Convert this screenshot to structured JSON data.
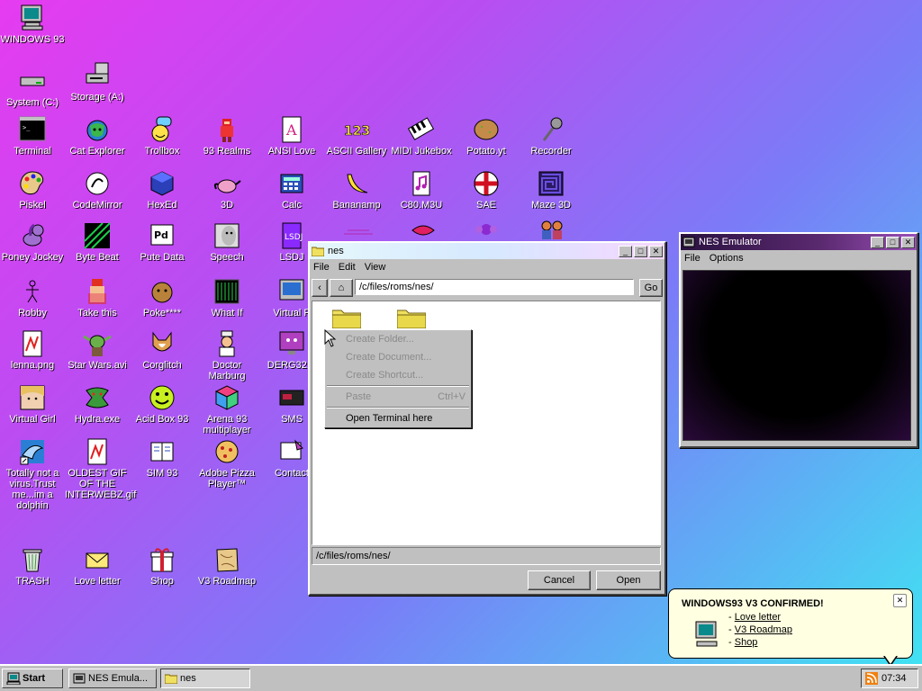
{
  "desktop": {
    "top_icons": [
      {
        "label": "WINDOWS 93",
        "icon": "computer-icon"
      },
      {
        "label": "System (C:)",
        "icon": "drive-icon"
      },
      {
        "label": "Storage (A:)",
        "icon": "floppy-drive-icon"
      }
    ],
    "icons_row1": [
      "Terminal",
      "Cat Explorer",
      "Trollbox",
      "93 Realms",
      "ANSI Love",
      "ASCII Gallery",
      "MIDI Jukebox",
      "Potato.yt",
      "Recorder"
    ],
    "icons_row2": [
      "Piskel",
      "CodeMirror",
      "HexEd",
      "3D",
      "Calc",
      "Bananamp",
      "C80.M3U",
      "SAE",
      "Maze 3D"
    ],
    "icons_row3": [
      "Poney Jockey",
      "Byte Beat",
      "Pute Data",
      "Speech",
      "LSDJ"
    ],
    "icons_row4": [
      "Robby",
      "Take this",
      "Poke****",
      "What If",
      "Virtual P"
    ],
    "icons_row5": [
      "lenna.png",
      "Star Wars.avi",
      "Corglitch",
      "Doctor Marburg",
      "DERG32.E"
    ],
    "icons_row6": [
      "Virtual Girl",
      "Hydra.exe",
      "Acid Box 93",
      "Arena 93 multiplayer",
      "SMS"
    ],
    "icons_row7": [
      "Totally not a virus.Trust me...im a dolphin",
      "OLDEST GIF OF THE INTERWEBZ.gif",
      "SIM 93",
      "Adobe Pizza Player™",
      "Contact"
    ],
    "icons_row8": [
      "TRASH",
      "Love letter",
      "Shop",
      "V3 Roadmap"
    ]
  },
  "file_window": {
    "title": "nes",
    "menu": [
      "File",
      "Edit",
      "View"
    ],
    "path": "/c/files/roms/nes/",
    "go_label": "Go",
    "status_path": "/c/files/roms/nes/",
    "cancel_label": "Cancel",
    "open_label": "Open"
  },
  "context_menu": {
    "items": [
      {
        "label": "Create Folder...",
        "enabled": false
      },
      {
        "label": "Create Document...",
        "enabled": false
      },
      {
        "label": "Create Shortcut...",
        "enabled": false
      },
      {
        "label": "Paste",
        "accel": "Ctrl+V",
        "enabled": false
      },
      {
        "label": "Open Terminal here",
        "enabled": true
      }
    ]
  },
  "nes_window": {
    "title": "NES Emulator",
    "menu": [
      "File",
      "Options"
    ]
  },
  "notification": {
    "title": "WINDOWS93 V3 CONFIRMED!",
    "links": [
      "Love letter",
      "V3 Roadmap",
      "Shop"
    ]
  },
  "taskbar": {
    "start_label": "Start",
    "items": [
      "NES Emula...",
      "nes"
    ],
    "clock": "07:34"
  },
  "colors": {
    "accent_bg_from": "#e63bf0",
    "accent_bg_to": "#3ee6f2",
    "window_face": "#c0c0c0"
  }
}
